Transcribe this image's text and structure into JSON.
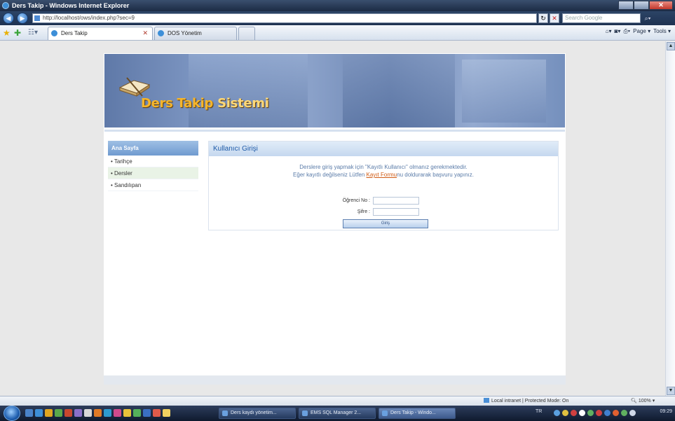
{
  "window": {
    "title": "Ders Takip - Windows Internet Explorer"
  },
  "addressbar": {
    "url": "http://localhost/ows/index.php?sec=9",
    "search_placeholder": "Search Google"
  },
  "tabs": [
    {
      "label": "Ders Takip",
      "active": true
    },
    {
      "label": "DOS Yönetim",
      "active": false
    }
  ],
  "commandbar": {
    "home": "Home",
    "feeds": "Feeds",
    "print": "Print",
    "page": "Page ▾",
    "tools": "Tools ▾"
  },
  "banner": {
    "title_part1": "Ders Takip",
    "title_part2": "Sistemi"
  },
  "sidebar": {
    "header": "Ana Sayfa",
    "items": [
      "Tarihçe",
      "Dersler",
      "Sandılıpan"
    ]
  },
  "content": {
    "header": "Kullanıcı Girişi",
    "message_line1": "Derslere giriş yapmak için \"Kayıtlı Kullanıcı\" olmanız gerekmektedir.",
    "message_line2_pre": "Eğer kayıtlı değilseniz Lütfen ",
    "message_link": "Kayıt Formu",
    "message_line2_post": "nu doldurarak başvuru yapınız.",
    "field_ogrenci_label": "Öğrenci No :",
    "field_sifre_label": "Şifre :",
    "login_button": "Giriş"
  },
  "statusbar": {
    "zone": "Local intranet | Protected Mode: On",
    "zoom": "100%"
  },
  "taskbar": {
    "tasks": [
      {
        "label": "Ders kaydı yönetim...",
        "active": false
      },
      {
        "label": "EMS SQL Manager 2...",
        "active": false
      },
      {
        "label": "Ders Takip - Windo...",
        "active": true
      }
    ],
    "lang": "TR",
    "clock": "09:29"
  },
  "colors": {
    "banner_title": "#f6b52a",
    "link": "#d05b14",
    "sidebar_header": "#6f9ad0",
    "content_header_text": "#1e5aa8"
  }
}
